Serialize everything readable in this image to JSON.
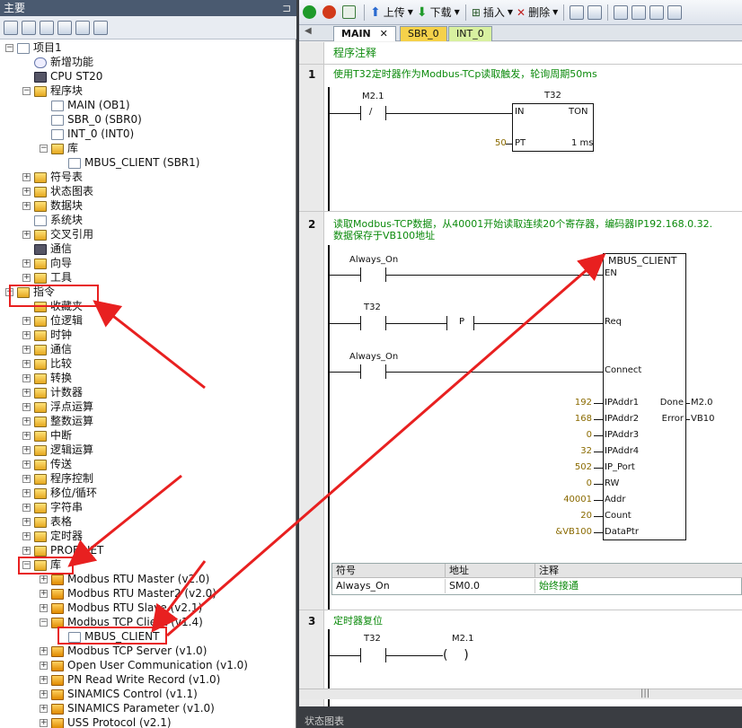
{
  "left_panel": {
    "title": "主要",
    "tree": [
      {
        "label": "项目1",
        "indent": 0,
        "exp": "−",
        "ic": "doc"
      },
      {
        "label": "新增功能",
        "indent": 1,
        "exp": "",
        "ic": "q"
      },
      {
        "label": "CPU ST20",
        "indent": 1,
        "exp": "",
        "ic": "cpu"
      },
      {
        "label": "程序块",
        "indent": 1,
        "exp": "−",
        "ic": "fold"
      },
      {
        "label": "MAIN (OB1)",
        "indent": 2,
        "exp": "",
        "ic": "doc"
      },
      {
        "label": "SBR_0 (SBR0)",
        "indent": 2,
        "exp": "",
        "ic": "doc"
      },
      {
        "label": "INT_0 (INT0)",
        "indent": 2,
        "exp": "",
        "ic": "doc"
      },
      {
        "label": "库",
        "indent": 2,
        "exp": "−",
        "ic": "fold"
      },
      {
        "label": "MBUS_CLIENT (SBR1)",
        "indent": 3,
        "exp": "",
        "ic": "doc"
      },
      {
        "label": "符号表",
        "indent": 1,
        "exp": "+",
        "ic": "fold"
      },
      {
        "label": "状态图表",
        "indent": 1,
        "exp": "+",
        "ic": "fold"
      },
      {
        "label": "数据块",
        "indent": 1,
        "exp": "+",
        "ic": "fold"
      },
      {
        "label": "系统块",
        "indent": 1,
        "exp": "",
        "ic": "doc"
      },
      {
        "label": "交叉引用",
        "indent": 1,
        "exp": "+",
        "ic": "fold"
      },
      {
        "label": "通信",
        "indent": 1,
        "exp": "",
        "ic": "cpu"
      },
      {
        "label": "向导",
        "indent": 1,
        "exp": "+",
        "ic": "fold"
      },
      {
        "label": "工具",
        "indent": 1,
        "exp": "+",
        "ic": "fold"
      },
      {
        "label": "指令",
        "indent": 0,
        "exp": "−",
        "ic": "fold"
      },
      {
        "label": "收藏夹",
        "indent": 1,
        "exp": "",
        "ic": "fold"
      },
      {
        "label": "位逻辑",
        "indent": 1,
        "exp": "+",
        "ic": "fold"
      },
      {
        "label": "时钟",
        "indent": 1,
        "exp": "+",
        "ic": "fold"
      },
      {
        "label": "通信",
        "indent": 1,
        "exp": "+",
        "ic": "fold"
      },
      {
        "label": "比较",
        "indent": 1,
        "exp": "+",
        "ic": "fold"
      },
      {
        "label": "转换",
        "indent": 1,
        "exp": "+",
        "ic": "fold"
      },
      {
        "label": "计数器",
        "indent": 1,
        "exp": "+",
        "ic": "fold"
      },
      {
        "label": "浮点运算",
        "indent": 1,
        "exp": "+",
        "ic": "fold"
      },
      {
        "label": "整数运算",
        "indent": 1,
        "exp": "+",
        "ic": "fold"
      },
      {
        "label": "中断",
        "indent": 1,
        "exp": "+",
        "ic": "fold"
      },
      {
        "label": "逻辑运算",
        "indent": 1,
        "exp": "+",
        "ic": "fold"
      },
      {
        "label": "传送",
        "indent": 1,
        "exp": "+",
        "ic": "fold"
      },
      {
        "label": "程序控制",
        "indent": 1,
        "exp": "+",
        "ic": "fold"
      },
      {
        "label": "移位/循环",
        "indent": 1,
        "exp": "+",
        "ic": "fold"
      },
      {
        "label": "字符串",
        "indent": 1,
        "exp": "+",
        "ic": "fold"
      },
      {
        "label": "表格",
        "indent": 1,
        "exp": "+",
        "ic": "fold"
      },
      {
        "label": "定时器",
        "indent": 1,
        "exp": "+",
        "ic": "fold"
      },
      {
        "label": "PROFINET",
        "indent": 1,
        "exp": "+",
        "ic": "fold"
      },
      {
        "label": "库",
        "indent": 1,
        "exp": "−",
        "ic": "fold"
      },
      {
        "label": "Modbus RTU Master (v2.0)",
        "indent": 2,
        "exp": "+",
        "ic": "libf"
      },
      {
        "label": "Modbus RTU Master2 (v2.0)",
        "indent": 2,
        "exp": "+",
        "ic": "libf"
      },
      {
        "label": "Modbus RTU Slave (v2.1)",
        "indent": 2,
        "exp": "+",
        "ic": "libf"
      },
      {
        "label": "Modbus TCP Client (v1.4)",
        "indent": 2,
        "exp": "−",
        "ic": "libf"
      },
      {
        "label": "MBUS_CLIENT",
        "indent": 3,
        "exp": "",
        "ic": "doc"
      },
      {
        "label": "Modbus TCP Server (v1.0)",
        "indent": 2,
        "exp": "+",
        "ic": "libf"
      },
      {
        "label": "Open User Communication (v1.0)",
        "indent": 2,
        "exp": "+",
        "ic": "libf"
      },
      {
        "label": "PN Read Write Record (v1.0)",
        "indent": 2,
        "exp": "+",
        "ic": "libf"
      },
      {
        "label": "SINAMICS Control (v1.1)",
        "indent": 2,
        "exp": "+",
        "ic": "libf"
      },
      {
        "label": "SINAMICS Parameter (v1.0)",
        "indent": 2,
        "exp": "+",
        "ic": "libf"
      },
      {
        "label": "USS Protocol (v2.1)",
        "indent": 2,
        "exp": "+",
        "ic": "libf"
      }
    ]
  },
  "toolbar": {
    "upload": "上传",
    "download": "下载",
    "insert": "插入",
    "delete": "删除"
  },
  "tabs": [
    {
      "label": "MAIN",
      "active": true
    },
    {
      "label": "SBR_0"
    },
    {
      "label": "INT_0"
    }
  ],
  "editor": {
    "program_comment": "程序注释",
    "net1": {
      "num": "1",
      "comment": "使用T32定时器作为Modbus-TCp读取触发，轮询周期50ms",
      "contact": "M2.1",
      "contact_sym": "/",
      "timer": "T32",
      "in": "IN",
      "ton": "TON",
      "pt": "PT",
      "pt_val": "50",
      "res": "1 ms"
    },
    "net2": {
      "num": "2",
      "comment1": "读取Modbus-TCP数据，从40001开始读取连续20个寄存器，编码器IP192.168.0.32.",
      "comment2": "数据保存于VB100地址",
      "block": "MBUS_CLIENT",
      "c1": "Always_On",
      "c2": "T32",
      "p": "P",
      "c3": "Always_On",
      "pins": [
        {
          "n": "EN",
          "v": ""
        },
        {
          "n": "Req",
          "v": ""
        },
        {
          "n": "Connect",
          "v": ""
        },
        {
          "n": "IPAddr1",
          "v": "192"
        },
        {
          "n": "IPAddr2",
          "v": "168"
        },
        {
          "n": "IPAddr3",
          "v": "0"
        },
        {
          "n": "IPAddr4",
          "v": "32"
        },
        {
          "n": "IP_Port",
          "v": "502"
        },
        {
          "n": "RW",
          "v": "0"
        },
        {
          "n": "Addr",
          "v": "40001"
        },
        {
          "n": "Count",
          "v": "20"
        },
        {
          "n": "DataPtr",
          "v": "&VB100"
        }
      ],
      "outs": [
        {
          "n": "Done",
          "v": "M2.0"
        },
        {
          "n": "Error",
          "v": "VB10"
        }
      ],
      "sym_head": [
        "符号",
        "地址",
        "注释"
      ],
      "sym_row": [
        "Always_On",
        "SM0.0",
        "始终接通"
      ]
    },
    "net3": {
      "num": "3",
      "comment": "定时器复位",
      "contact": "T32",
      "coil": "M2.1"
    }
  },
  "status": "状态图表",
  "colors": {
    "annotation": "#e82020",
    "comment": "#0b8a0b"
  }
}
